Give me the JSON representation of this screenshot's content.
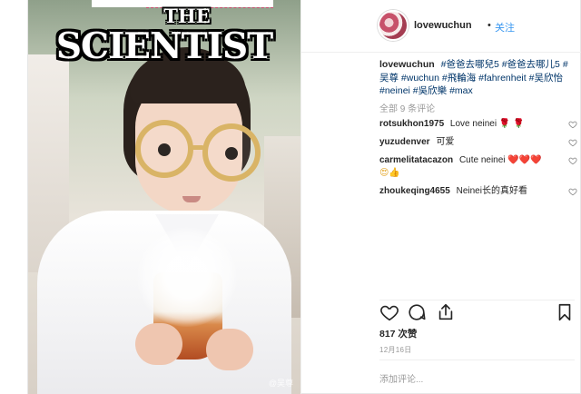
{
  "photo": {
    "title_small": "THE",
    "title_large": "SCIENTIST",
    "watermark": "@吴尊"
  },
  "header": {
    "username": "lovewuchun",
    "separator": "•",
    "follow_label": "关注"
  },
  "caption": {
    "username": "lovewuchun",
    "hashtags": [
      "#爸爸去哪兒5",
      "#爸爸去哪儿5",
      "#吴尊",
      "#wuchun",
      "#飛輪海",
      "#fahrenheit",
      "#吴欣怡",
      "#neinei",
      "#吳欣樂",
      "#max"
    ]
  },
  "comments_summary": "全部 9 条评论",
  "comments": [
    {
      "username": "rotsukhon1975",
      "text": "Love neinei",
      "emoji": "🌹 🌹"
    },
    {
      "username": "yuzudenver",
      "text": "可爱",
      "emoji": ""
    },
    {
      "username": "carmelitatacazon",
      "text": "Cute neinei",
      "emoji": "❤️❤️❤️",
      "emoji2": "😍👍"
    },
    {
      "username": "zhoukeqing4655",
      "text": "Neinei长的真好看",
      "emoji": ""
    }
  ],
  "actions": {
    "like_icon": "heart-outline-icon",
    "comment_icon": "speech-bubble-icon",
    "share_icon": "share-icon",
    "save_icon": "bookmark-icon"
  },
  "likes": "817 次赞",
  "date": "12月16日",
  "add_comment_placeholder": "添加评论..."
}
